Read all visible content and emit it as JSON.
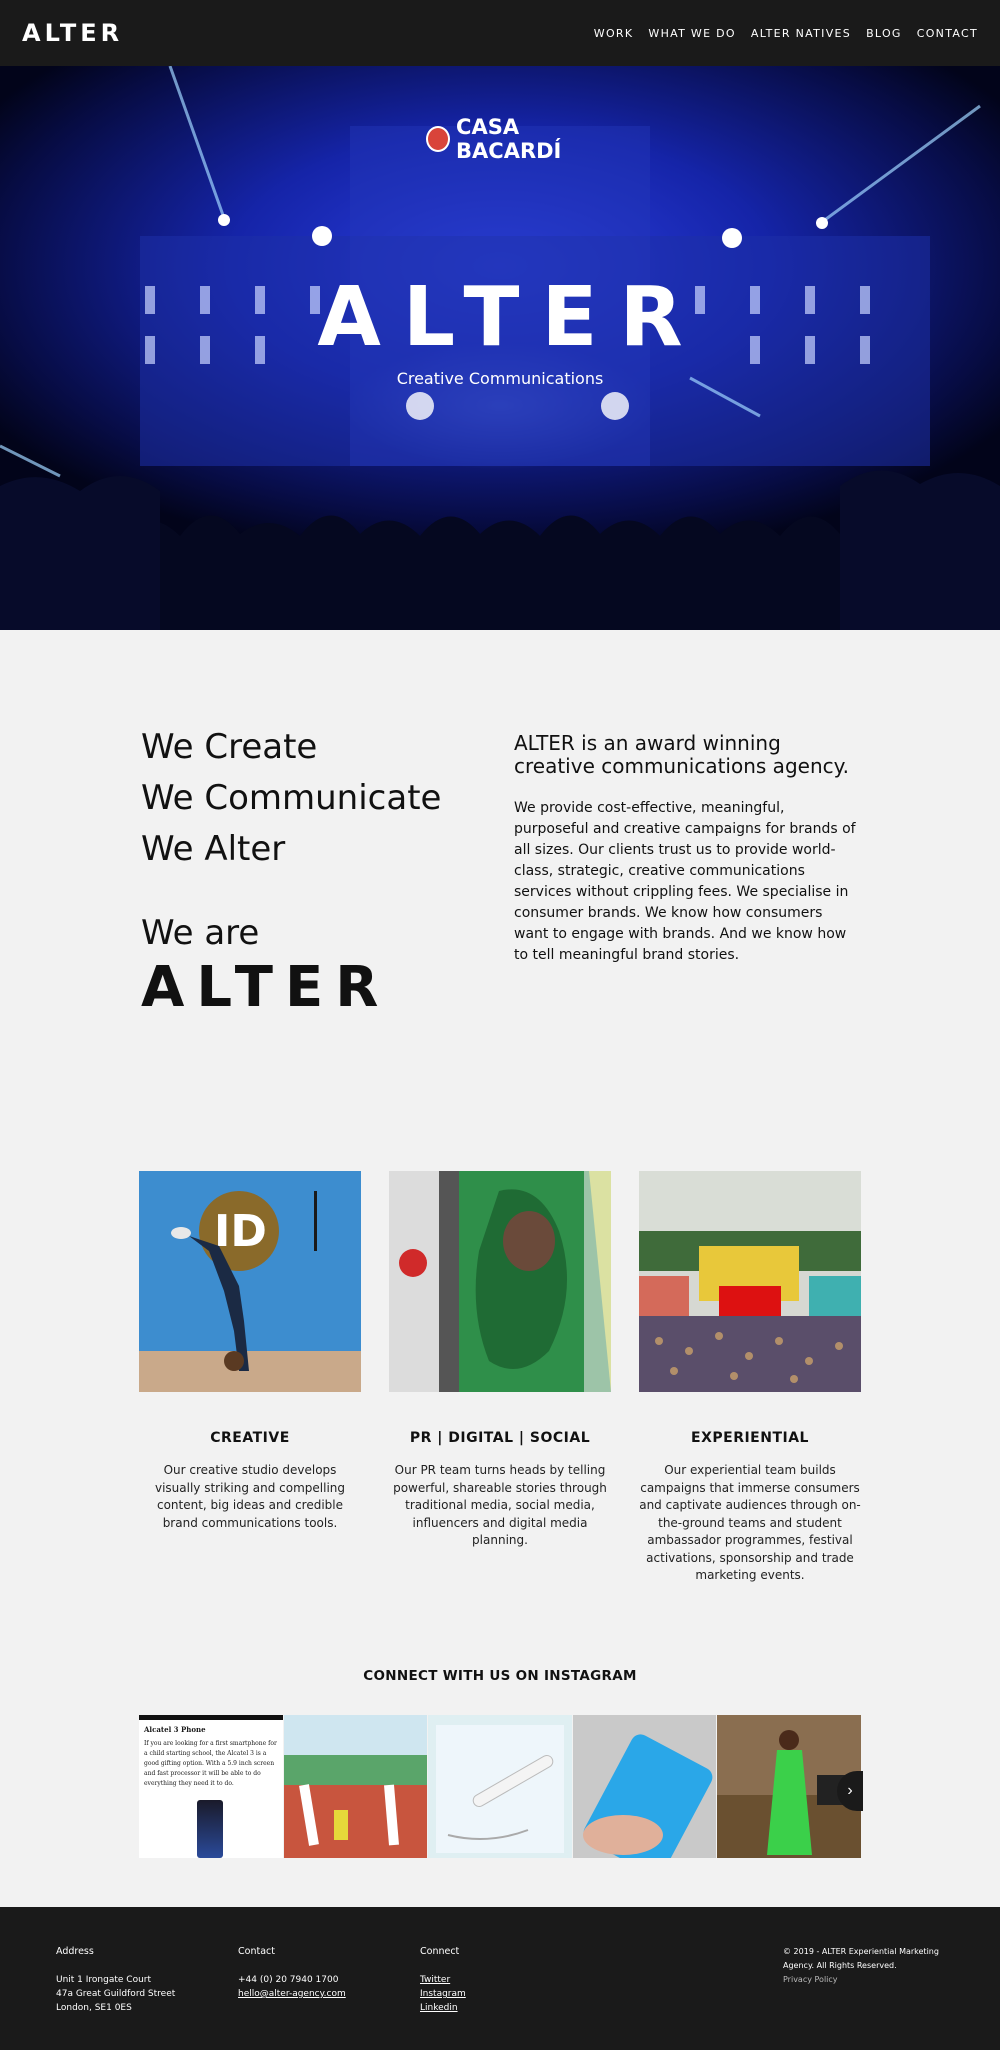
{
  "header": {
    "logo": "ALTER",
    "nav": [
      "WORK",
      "WHAT WE DO",
      "ALTER NATIVES",
      "BLOG",
      "CONTACT"
    ]
  },
  "hero": {
    "brand_sign": "CASA BACARDÍ",
    "title": "ALTER",
    "subtitle": "Creative Communications"
  },
  "intro": {
    "taglines": [
      "We Create",
      "We Communicate",
      "We Alter"
    ],
    "we_are": "We are",
    "brand": "ALTER",
    "heading": "ALTER is an award winning creative communications agency.",
    "body": "We provide cost-effective, meaningful, purposeful and creative campaigns for brands of all sizes. Our clients trust us to provide world-class, strategic, creative communications services without crippling fees. We specialise in consumer brands. We know how consumers want to engage with brands. And we know how to tell meaningful brand stories."
  },
  "services": [
    {
      "title": "CREATIVE",
      "text": "Our creative studio develops visually striking and compelling content, big ideas and credible brand communications tools."
    },
    {
      "title": "PR | DIGITAL | SOCIAL",
      "text": "Our PR team turns heads by telling powerful, shareable stories through traditional media, social media, influencers and digital media planning."
    },
    {
      "title": "EXPERIENTIAL",
      "text": "Our experiential team builds campaigns that immerse consumers and captivate audiences through on-the-ground teams and student ambassador programmes, festival activations, sponsorship and trade marketing events."
    }
  ],
  "instagram": {
    "title": "CONNECT WITH US ON INSTAGRAM",
    "post1_title": "Alcatel 3 Phone",
    "post1_text": "If you are looking for a first smartphone for a child starting school, the Alcatel 3 is a good gifting option. With a 5.9 inch screen and fast processor it will be able to do everything they need it to do.",
    "next_icon": "chevron-right-icon"
  },
  "footer": {
    "address_label": "Address",
    "address_lines": [
      "Unit 1 Irongate Court",
      "47a Great Guildford Street",
      "London, SE1 0ES"
    ],
    "contact_label": "Contact",
    "phone": "+44 (0) 20 7940 1700",
    "email": "hello@alter-agency.com",
    "connect_label": "Connect",
    "links": [
      "Twitter",
      "Instagram",
      "Linkedin"
    ],
    "copyright": "© 2019 - ALTER Experiential Marketing Agency. All Rights Reserved.",
    "privacy": "Privacy Policy"
  },
  "colors": {
    "header_bg": "#1a1a1a",
    "page_bg": "#f2f2f2",
    "hero_blue": "#1f33c9"
  }
}
